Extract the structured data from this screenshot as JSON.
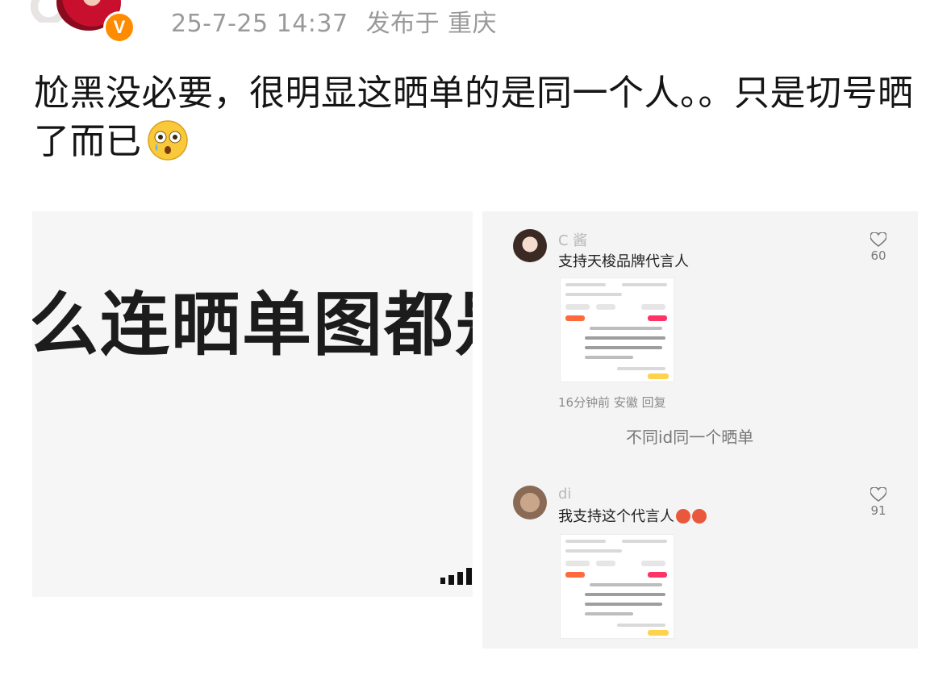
{
  "post": {
    "timestamp": "25-7-25 14:37",
    "location": "发布于 重庆",
    "verified_badge": "V",
    "text": "尬黑没必要，很明显这晒单的是同一个人。。只是切号晒了而已",
    "emoji": "crying-flushed-face-icon"
  },
  "left_image": {
    "text": "么连晒单图都是"
  },
  "right_image": {
    "comments": [
      {
        "user": "C     酱",
        "text": "支持天梭品牌代言人",
        "likes": "60",
        "meta": "16分钟前 安徽 回复"
      },
      {
        "user": "    di",
        "text": "我支持这个代言人",
        "likes": "91"
      }
    ],
    "center_note": "不同id同一个晒单"
  },
  "colors": {
    "meta_gray": "#9a9a9a",
    "badge_orange": "#ff8c00",
    "text_dark": "#151515"
  }
}
